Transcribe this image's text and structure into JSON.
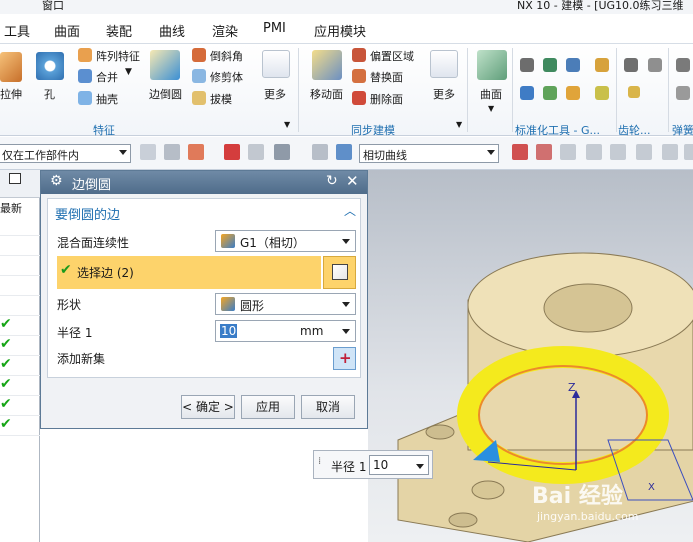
{
  "titlebar": {
    "window_menu": "窗口",
    "title": "NX 10 - 建模 - [UG10.0练习三维"
  },
  "menu": {
    "tabs": [
      "工具",
      "曲面",
      "装配",
      "曲线",
      "渲染",
      "PMI",
      "应用模块"
    ]
  },
  "ribbon": {
    "items": {
      "extrude": "拉伸",
      "hole": "孔",
      "pattern": "阵列特征",
      "unite": "合并",
      "shell": "抽壳",
      "edge_blend": "边倒圆",
      "chamfer": "倒斜角",
      "trim_body": "修剪体",
      "draft": "拔模",
      "more": "更多",
      "move_face": "移动面",
      "offset_region": "偏置区域",
      "replace_face": "替换面",
      "delete_face": "删除面",
      "more2": "更多",
      "surface": "曲面"
    },
    "groups": {
      "feature": "特征",
      "sync": "同步建模",
      "standard": "标准化工具 - G...",
      "gear": "齿轮...",
      "spring": "弹簧"
    }
  },
  "filterbar": {
    "scope": "仅在工作部件内",
    "curve_rule": "相切曲线"
  },
  "navigator": {
    "header": "最新",
    "checks": [
      "✔",
      "✔",
      "✔",
      "✔",
      "✔",
      "✔"
    ]
  },
  "dialog": {
    "title": "边倒圆",
    "section_title": "要倒圆的边",
    "continuity_label": "混合面连续性",
    "continuity_value": "G1（相切）",
    "select_edge": "选择边 (2)",
    "shape_label": "形状",
    "shape_value": "圆形",
    "radius_label": "半径 1",
    "radius_value": "10",
    "radius_unit": "mm",
    "add_set_label": "添加新集",
    "ok": "< 确定 >",
    "apply": "应用",
    "cancel": "取消"
  },
  "float_radius": {
    "label": "半径 1",
    "value": "10"
  },
  "viewport": {
    "axis_z": "Z",
    "axis_x": "X"
  },
  "watermark": {
    "main": "Bai 经验",
    "sub": "jingyan.baidu.com"
  },
  "colors": {
    "accent": "#1f6fb0",
    "selection": "#fdd36b",
    "dialog_title": "#5d7a96",
    "model": "#e3d3a4",
    "highlight": "#f4ea1d"
  }
}
